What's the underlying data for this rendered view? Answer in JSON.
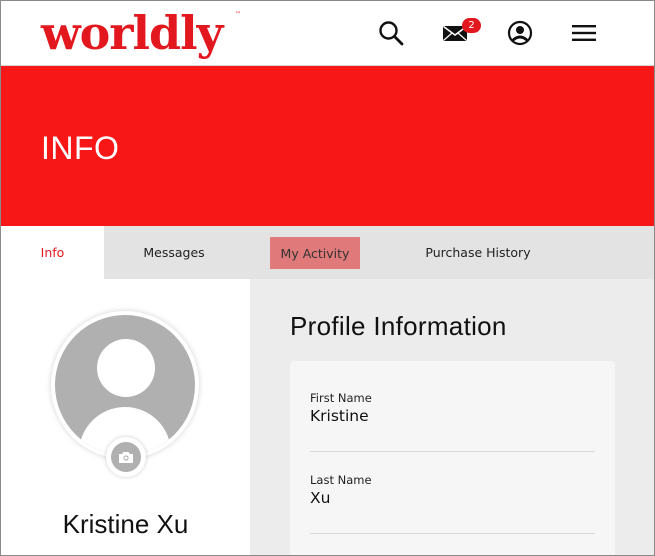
{
  "header": {
    "logo_text": "worldly",
    "logo_tm": "™",
    "brand_color": "#e3181f",
    "icons": [
      "search-icon",
      "mail-icon",
      "account-icon",
      "menu-icon"
    ],
    "mail_badge_count": "2"
  },
  "banner": {
    "title": "INFO",
    "color": "#f81717"
  },
  "tabs": [
    {
      "label": "Info",
      "state": "active"
    },
    {
      "label": "Messages",
      "state": "normal"
    },
    {
      "label": "My Activity",
      "state": "hover"
    },
    {
      "label": "Purchase History",
      "state": "normal"
    }
  ],
  "profile": {
    "name": "Kristine Xu",
    "avatar_icon": "user-placeholder-icon",
    "camera_icon": "camera-icon"
  },
  "profile_info": {
    "title": "Profile Information",
    "fields": [
      {
        "label": "First Name",
        "value": "Kristine"
      },
      {
        "label": "Last Name",
        "value": "Xu"
      }
    ]
  }
}
